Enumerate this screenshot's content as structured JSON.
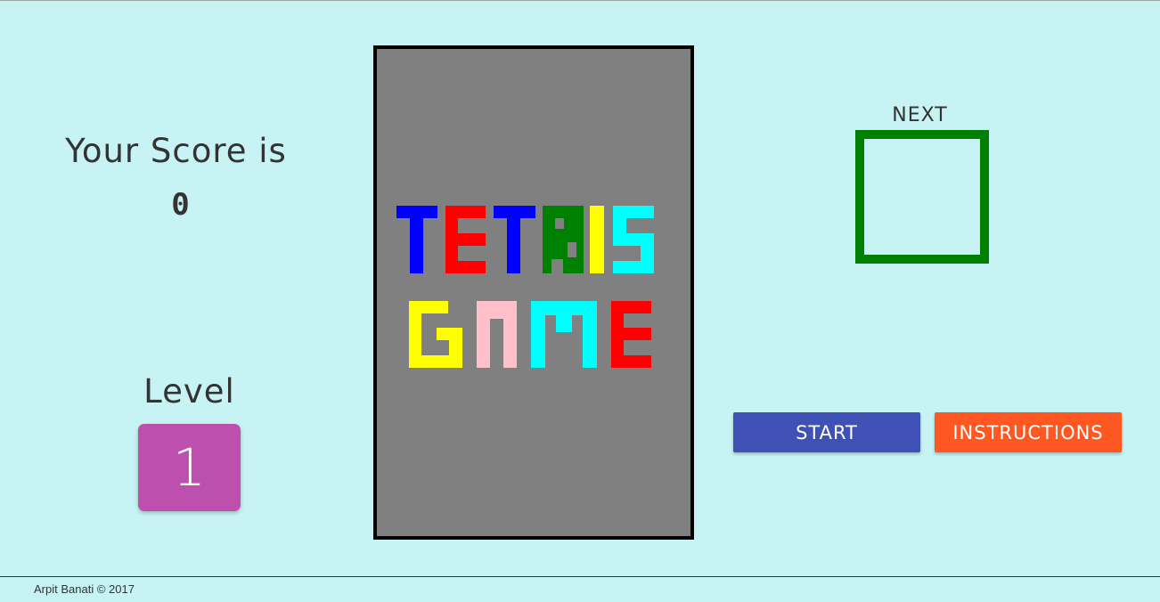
{
  "score": {
    "title": "Your Score is",
    "value": "0"
  },
  "level": {
    "title": "Level",
    "value": "1",
    "color": "#bd4fae"
  },
  "board": {
    "title_line_1": "TETRIS",
    "title_line_2": "GAME",
    "background": "#808080",
    "letter_colors_line_1": [
      "#0000ff",
      "#ff0000",
      "#0000ff",
      "#008000",
      "#ffff00",
      "#00ffff"
    ],
    "letter_colors_line_2": [
      "#ffff00",
      "#ffc0cb",
      "#00ffff",
      "#ff0000"
    ]
  },
  "next": {
    "label": "NEXT",
    "border_color": "#008000"
  },
  "buttons": {
    "start_label": "START",
    "start_color": "#3f51b5",
    "instructions_label": "INSTRUCTIONS",
    "instructions_color": "#ff5722"
  },
  "footer": {
    "text": "Arpit Banati © 2017"
  }
}
